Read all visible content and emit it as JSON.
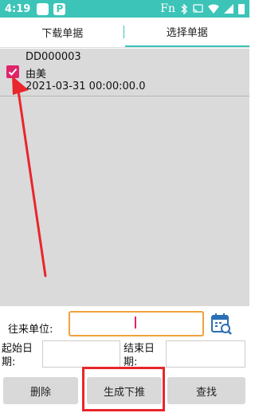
{
  "statusbar": {
    "time": "4:19",
    "p_label": "P",
    "fn_label": "Fn"
  },
  "tabs": [
    {
      "label": "下载单据",
      "active": false
    },
    {
      "label": "选择单据",
      "active": true
    }
  ],
  "list": {
    "items": [
      {
        "code": "DD000003",
        "name": "由美",
        "datetime": "2021-03-31 00:00:00.0",
        "checked": true
      }
    ]
  },
  "form": {
    "partner_label": "往来单位:",
    "partner_value": "",
    "start_date_label": "起始日期:",
    "start_date_value": "",
    "end_date_label": "结束日期:",
    "end_date_value": ""
  },
  "buttons": {
    "delete": "删除",
    "generate": "生成下推",
    "search": "查找"
  },
  "colors": {
    "statusbar": "#3cc4b8",
    "accent": "#e0246c",
    "input_focus_border": "#f0a23c",
    "annotation": "#e8262c"
  },
  "icons": {
    "calendar": "calendar-search-icon",
    "check": "check-icon"
  }
}
